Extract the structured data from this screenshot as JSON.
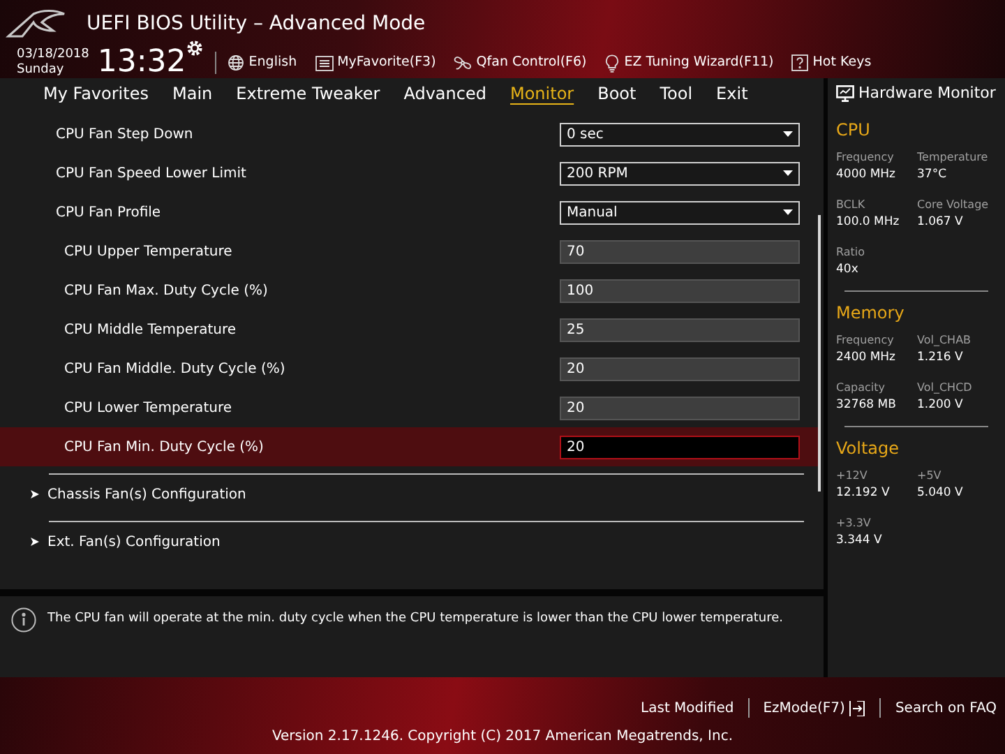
{
  "header": {
    "title": "UEFI BIOS Utility – Advanced Mode",
    "date": "03/18/2018",
    "day": "Sunday",
    "time": "13:32",
    "tools": [
      {
        "kind": "globe",
        "label": "English"
      },
      {
        "kind": "favorite",
        "label": "MyFavorite(F3)"
      },
      {
        "kind": "fan",
        "label": "Qfan Control(F6)"
      },
      {
        "kind": "bulb",
        "label": "EZ Tuning Wizard(F11)"
      },
      {
        "kind": "help",
        "label": "Hot Keys"
      }
    ]
  },
  "tabs": [
    {
      "label": "My Favorites",
      "selected": false
    },
    {
      "label": "Main",
      "selected": false
    },
    {
      "label": "Extreme Tweaker",
      "selected": false
    },
    {
      "label": "Advanced",
      "selected": false
    },
    {
      "label": "Monitor",
      "selected": true
    },
    {
      "label": "Boot",
      "selected": false
    },
    {
      "label": "Tool",
      "selected": false
    },
    {
      "label": "Exit",
      "selected": false
    }
  ],
  "settings": [
    {
      "kind": "dropdown",
      "label": "CPU Fan Step Down",
      "value": "0 sec",
      "selected": false
    },
    {
      "kind": "dropdown",
      "label": "CPU Fan Speed Lower Limit",
      "value": "200 RPM",
      "selected": false
    },
    {
      "kind": "dropdown",
      "label": "CPU Fan Profile",
      "value": "Manual",
      "selected": false
    },
    {
      "kind": "number",
      "label": "CPU Upper Temperature",
      "value": "70",
      "selected": false
    },
    {
      "kind": "number",
      "label": "CPU Fan Max. Duty Cycle (%)",
      "value": "100",
      "selected": false
    },
    {
      "kind": "number",
      "label": "CPU Middle Temperature",
      "value": "25",
      "selected": false
    },
    {
      "kind": "number",
      "label": "CPU Fan Middle. Duty Cycle (%)",
      "value": "20",
      "selected": false
    },
    {
      "kind": "number",
      "label": "CPU Lower Temperature",
      "value": "20",
      "selected": false
    },
    {
      "kind": "number",
      "label": "CPU Fan Min. Duty Cycle (%)",
      "value": "20",
      "selected": true
    }
  ],
  "submenus": [
    {
      "label": "Chassis Fan(s) Configuration"
    },
    {
      "label": "Ext. Fan(s) Configuration"
    }
  ],
  "help_text": "The CPU fan will operate at the min. duty cycle when the CPU temperature is lower than the CPU lower temperature.",
  "hardware_monitor": {
    "title": "Hardware Monitor",
    "sections": [
      {
        "title": "CPU",
        "items": [
          {
            "label": "Frequency",
            "value": "4000 MHz"
          },
          {
            "label": "Temperature",
            "value": "37°C"
          },
          {
            "label": "BCLK",
            "value": "100.0 MHz"
          },
          {
            "label": "Core Voltage",
            "value": "1.067 V"
          },
          {
            "label": "Ratio",
            "value": "40x"
          }
        ]
      },
      {
        "title": "Memory",
        "items": [
          {
            "label": "Frequency",
            "value": "2400 MHz"
          },
          {
            "label": "Vol_CHAB",
            "value": "1.216 V"
          },
          {
            "label": "Capacity",
            "value": "32768 MB"
          },
          {
            "label": "Vol_CHCD",
            "value": "1.200 V"
          }
        ]
      },
      {
        "title": "Voltage",
        "items": [
          {
            "label": "+12V",
            "value": "12.192 V"
          },
          {
            "label": "+5V",
            "value": "5.040 V"
          },
          {
            "label": "+3.3V",
            "value": "3.344 V"
          }
        ]
      }
    ]
  },
  "footer": {
    "links": [
      {
        "label": "Last Modified"
      },
      {
        "label": "EzMode(F7)",
        "icon": true
      },
      {
        "label": "Search on FAQ"
      }
    ],
    "version": "Version 2.17.1246. Copyright (C) 2017 American Megatrends, Inc."
  }
}
